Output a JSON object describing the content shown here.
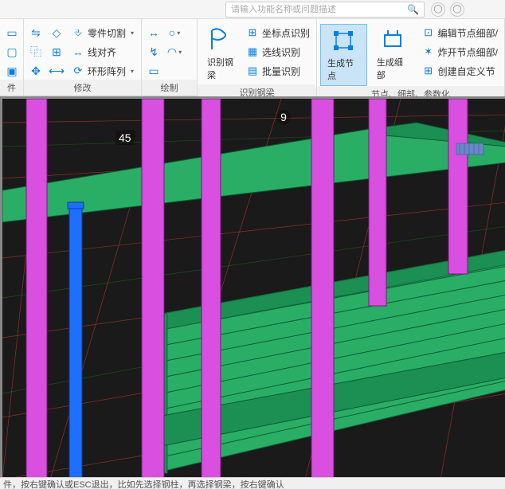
{
  "search": {
    "placeholder": "请输入功能名称或问题描述"
  },
  "ribbon": {
    "group_edit": {
      "part_cut": "零件切割",
      "line_align": "线对齐",
      "ring_array": "环形阵列",
      "label": "修改"
    },
    "group_draw": {
      "label": "绘制"
    },
    "group_recog": {
      "recog_steel": "识别钢梁",
      "coord_recog": "坐标点识别",
      "line_recog": "选线识别",
      "batch_recog": "批量识别",
      "label": "识别钢梁"
    },
    "group_node": {
      "gen_node": "生成节点",
      "gen_detail": "生成细部",
      "edit_node_detail": "编辑节点细部/",
      "explode_node_detail": "炸开节点细部/",
      "create_custom_node": "创建自定义节",
      "label": "节点、细部、参数化"
    }
  },
  "viewport": {
    "label_45": "45",
    "label_9": "9"
  },
  "statusbar": {
    "text": "件，按右键确认或ESC退出，比如先选择钢柱，再选择钢梁，按右键确认"
  }
}
